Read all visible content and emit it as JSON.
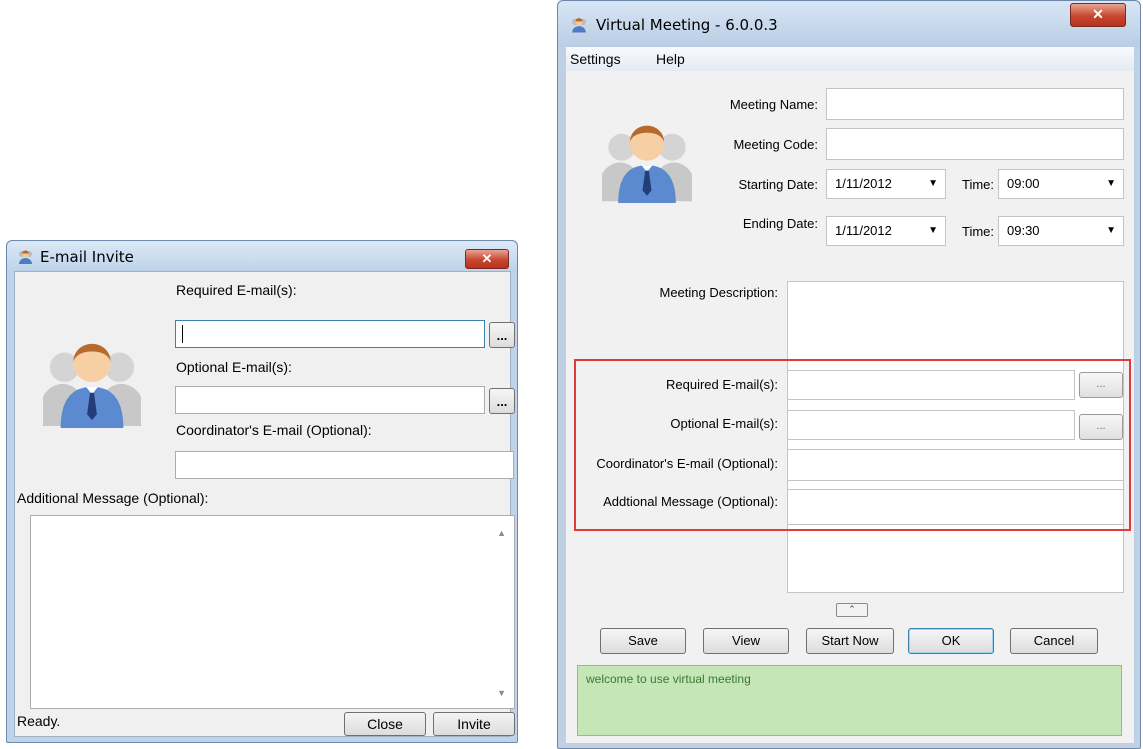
{
  "invite_window": {
    "title": "E-mail Invite",
    "close_glyph": "✕",
    "required_label": "Required E-mail(s):",
    "required_value": "",
    "optional_label": "Optional E-mail(s):",
    "optional_value": "",
    "coordinator_label": "Coordinator's E-mail (Optional):",
    "coordinator_value": "",
    "message_label": "Additional Message (Optional):",
    "message_value": "",
    "browse_label": "...",
    "status": "Ready.",
    "close_button": "Close",
    "invite_button": "Invite",
    "scroll_up_glyph": "▲",
    "scroll_down_glyph": "▼",
    "icons": [
      "user-avatar-icon"
    ]
  },
  "meeting_window": {
    "title": "Virtual Meeting - 6.0.0.3",
    "close_glyph": "✕",
    "menu": [
      "Settings",
      "Help"
    ],
    "meeting_name_label": "Meeting Name:",
    "meeting_name_value": "",
    "meeting_code_label": "Meeting Code:",
    "meeting_code_value": "",
    "starting_date_label": "Starting Date:",
    "starting_date_value": "1/11/2012",
    "starting_time_label": "Time:",
    "starting_time_value": "09:00",
    "ending_date_label": "Ending Date:",
    "ending_date_value": "1/11/2012",
    "ending_time_label": "Time:",
    "ending_time_value": "09:30",
    "description_label": "Meeting Description:",
    "required_label": "Required E-mail(s):",
    "optional_label": "Optional E-mail(s):",
    "coordinator_label": "Coordinator's E-mail (Optional):",
    "message_label": "Addtional Message (Optional):",
    "browse_label": "...",
    "dropdown_glyph": "▼",
    "collapse_glyph": "⌃",
    "buttons": [
      "Save",
      "View",
      "Start Now",
      "OK",
      "Cancel"
    ],
    "status_message": "welcome to use virtual meeting",
    "highlight_color": "#e03a3a",
    "status_color": "#c5e6b7"
  }
}
